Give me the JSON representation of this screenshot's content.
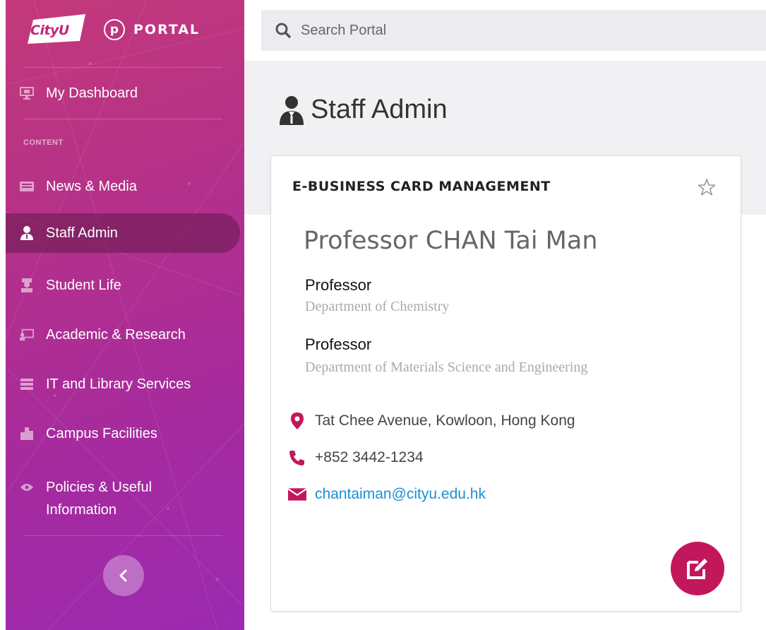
{
  "sidebar": {
    "brand": {
      "logo_text": "CityU",
      "portal_mark": "p",
      "portal_label": "PORTAL"
    },
    "dashboard": {
      "label": "My Dashboard",
      "icon": "monitor-icon"
    },
    "section_label": "CONTENT",
    "items": [
      {
        "label": "News & Media",
        "icon": "newspaper-icon",
        "active": false
      },
      {
        "label": "Staff Admin",
        "icon": "staff-icon",
        "active": true
      },
      {
        "label": "Student Life",
        "icon": "student-icon",
        "active": false
      },
      {
        "label": "Academic & Research",
        "icon": "presentation-icon",
        "active": false
      },
      {
        "label": "IT and Library Services",
        "icon": "server-icon",
        "active": false
      },
      {
        "label": "Campus Facilities",
        "icon": "building-icon",
        "active": false
      },
      {
        "label": "Policies & Useful",
        "label2": "Information",
        "icon": "eye-icon",
        "active": false
      }
    ],
    "collapse_icon": "chevron-left-icon"
  },
  "search": {
    "placeholder": "Search Portal"
  },
  "page": {
    "title": "Staff Admin",
    "title_icon": "staff-icon"
  },
  "card": {
    "header": "E-BUSINESS CARD MANAGEMENT",
    "name": "Professor CHAN Tai Man",
    "positions": [
      {
        "role": "Professor",
        "department": "Department of Chemistry"
      },
      {
        "role": "Professor",
        "department": "Department of Materials Science and Engineering"
      }
    ],
    "address": "Tat Chee Avenue, Kowloon, Hong Kong",
    "phone": "+852 3442-1234",
    "email": "chantaiman@cityu.edu.hk"
  },
  "colors": {
    "sidebar_gradient_start": "#c3397a",
    "sidebar_gradient_end": "#9c2ab0",
    "accent": "#c2185b",
    "link": "#1b8fd8"
  }
}
